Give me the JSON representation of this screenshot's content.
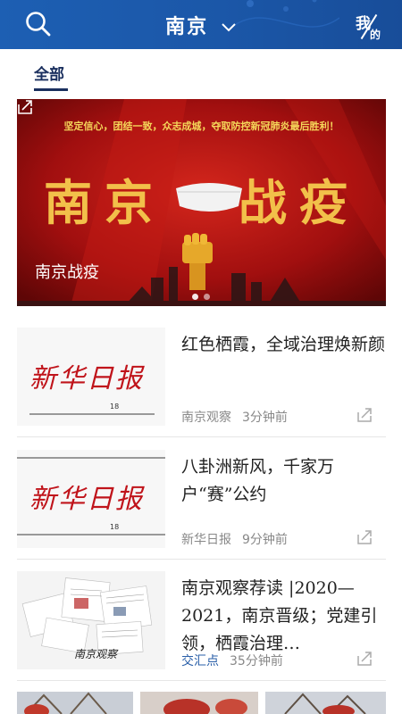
{
  "header": {
    "city": "南京",
    "me_label_top": "我",
    "me_label_bottom": "的",
    "colors": {
      "header_bg": "#1b57a8",
      "tab_active": "#1a2f5e"
    }
  },
  "tabs": [
    {
      "label": "全部",
      "active": true
    }
  ],
  "banner": {
    "slogan": "坚定信心，团结一致，众志成城，夺取防控新冠肺炎最后胜利！",
    "headline_left": "南京",
    "headline_right": "战疫",
    "caption": "南京战疫",
    "slides": 2,
    "current_slide": 1
  },
  "articles": [
    {
      "title": "红色栖霞，全域治理焕新颜",
      "source": "南京观察",
      "time": "3分钟前",
      "thumb_text": "新华日报",
      "thumb_page": "18"
    },
    {
      "title": "八卦洲新风，千家万户“赛”公约",
      "source": "新华日报",
      "time": "9分钟前",
      "thumb_text": "新华日报",
      "thumb_page": "18"
    },
    {
      "title": "南京观察荐读 |2020—2021，南京晋级；党建引领，栖霞治理…",
      "source": "交汇点",
      "time": "35分钟前",
      "thumb_text": "南京观察"
    }
  ]
}
